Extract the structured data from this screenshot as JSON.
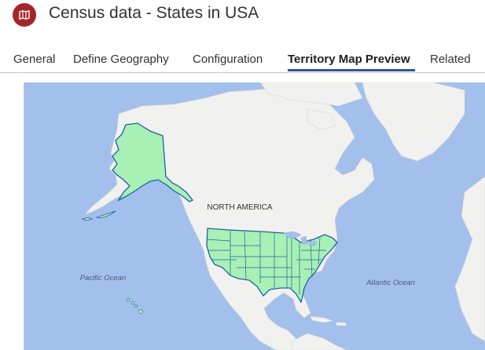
{
  "header": {
    "title": "Census data - States in USA",
    "icon": "map-icon",
    "icon_color": "#a4262c"
  },
  "tabs": [
    {
      "label": "General",
      "active": false
    },
    {
      "label": "Define Geography",
      "active": false
    },
    {
      "label": "Configuration",
      "active": false
    },
    {
      "label": "Territory Map Preview",
      "active": true
    },
    {
      "label": "Related",
      "active": false
    }
  ],
  "map": {
    "labels": {
      "continent": "NORTH AMERICA",
      "pacific": "Pacific Ocean",
      "atlantic": "Atlantic Ocean"
    },
    "colors": {
      "ocean": "#a3c0ec",
      "land": "#f1f1ef",
      "territory_fill": "#a8f0b4",
      "territory_border": "#1f5fa8"
    }
  }
}
